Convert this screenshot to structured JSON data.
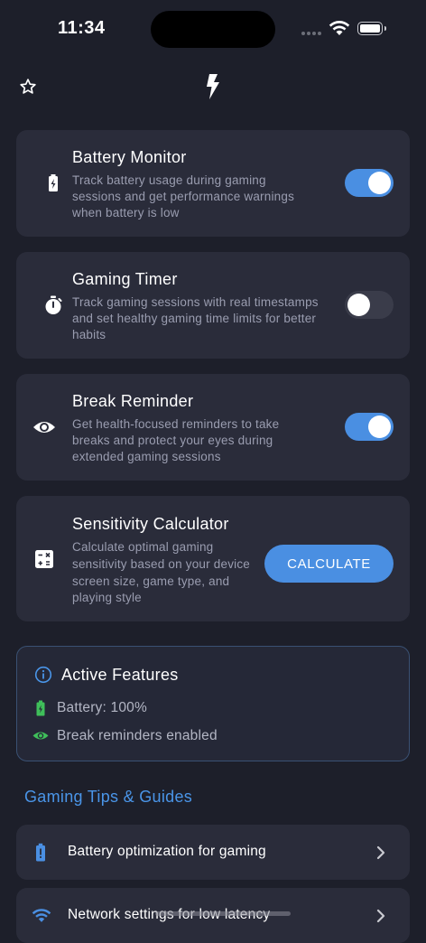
{
  "status_bar": {
    "time": "11:34",
    "battery_level": 1.0
  },
  "cards": [
    {
      "title": "Battery Monitor",
      "description": "Track battery usage during gaming sessions and get performance warnings when battery is low",
      "toggle_on": true,
      "icon": "battery-bolt-icon"
    },
    {
      "title": "Gaming Timer",
      "description": "Track gaming sessions with real timestamps and set healthy gaming time limits for better habits",
      "toggle_on": false,
      "icon": "stopwatch-icon"
    },
    {
      "title": "Break Reminder",
      "description": "Get health-focused reminders to take breaks and protect your eyes during extended gaming sessions",
      "toggle_on": true,
      "icon": "eye-icon"
    },
    {
      "title": "Sensitivity Calculator",
      "description": "Calculate optimal gaming sensitivity based on your device screen size, game type, and playing style",
      "button": "CALCULATE",
      "icon": "calculator-icon"
    }
  ],
  "active_features": {
    "title": "Active Features",
    "items": [
      {
        "label": "Battery: 100%",
        "icon": "battery-icon",
        "color": "#3fbf5a"
      },
      {
        "label": "Break reminders enabled",
        "icon": "eye-icon",
        "color": "#3fbf5a"
      }
    ]
  },
  "tips": {
    "title": "Gaming Tips & Guides",
    "items": [
      {
        "label": "Battery optimization for gaming",
        "icon": "battery-alert-icon"
      },
      {
        "label": "Network settings for low latency",
        "icon": "wifi-icon"
      }
    ]
  },
  "colors": {
    "accent": "#4a8fe2",
    "background": "#1d1f2a",
    "card": "#2a2c3a",
    "success": "#3fbf5a"
  }
}
